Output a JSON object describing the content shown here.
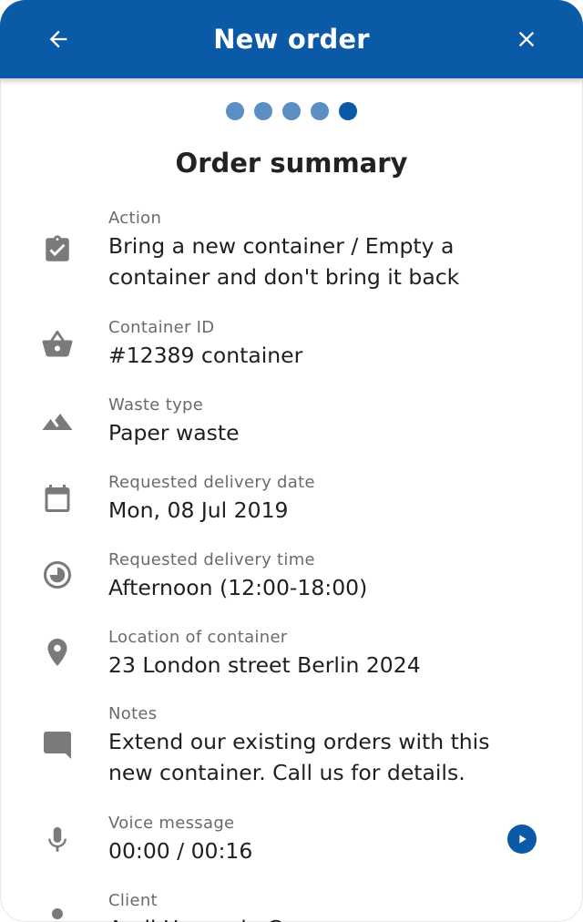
{
  "appbar": {
    "title": "New order",
    "back_icon": "arrow-left-icon",
    "close_icon": "close-icon",
    "color": "#0b5aa8"
  },
  "stepper": {
    "total_steps": 5,
    "current_step": 5
  },
  "heading": "Order summary",
  "fields": [
    {
      "icon": "clipboard-check-icon",
      "label": "Action",
      "value": "Bring a new container / Empty a container and don't bring it back"
    },
    {
      "icon": "basket-icon",
      "label": "Container ID",
      "value": "#12389 container"
    },
    {
      "icon": "mountain-icon",
      "label": "Waste type",
      "value": "Paper waste"
    },
    {
      "icon": "calendar-icon",
      "label": "Requested delivery date",
      "value": "Mon, 08 Jul 2019"
    },
    {
      "icon": "clock-icon",
      "label": "Requested delivery time",
      "value": "Afternoon (12:00-18:00)"
    },
    {
      "icon": "location-pin-icon",
      "label": "Location of container",
      "value": "23 London street Berlin 2024"
    },
    {
      "icon": "comment-icon",
      "label": "Notes",
      "value": "Extend our existing orders with this new container. Call us for details."
    },
    {
      "icon": "microphone-icon",
      "label": "Voice message",
      "value": "00:00 / 00:16",
      "action_icon": "play-icon"
    },
    {
      "icon": "person-icon",
      "label": "Client",
      "value": "Audi Hamm in Co."
    }
  ]
}
